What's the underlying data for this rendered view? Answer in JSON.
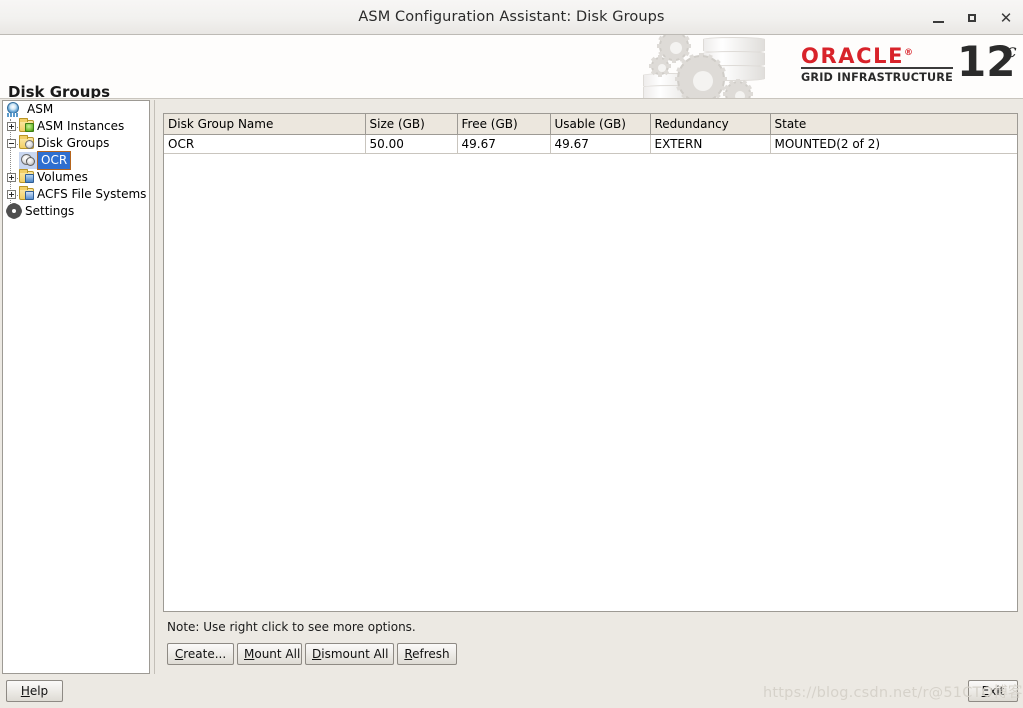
{
  "window": {
    "title": "ASM Configuration Assistant: Disk Groups",
    "minimize_label": "Minimize",
    "maximize_label": "Maximize",
    "close_label": "Close"
  },
  "header": {
    "page_title": "Disk Groups",
    "brand": {
      "name": "ORACLE",
      "registered_mark": "®",
      "product_line": "GRID INFRASTRUCTURE",
      "version_number": "12",
      "version_suffix": "c"
    },
    "brand_color": "#d8232a"
  },
  "sidebar": {
    "nodes": [
      {
        "label": "ASM",
        "icon": "asm-node-icon",
        "level": 0,
        "expander": "none",
        "selected": false
      },
      {
        "label": "ASM Instances",
        "icon": "asm-instances-icon",
        "level": 1,
        "expander": "plus",
        "selected": false
      },
      {
        "label": "Disk Groups",
        "icon": "disk-groups-icon",
        "level": 1,
        "expander": "minus",
        "selected": false
      },
      {
        "label": "OCR",
        "icon": "disk-group-item-icon",
        "level": 2,
        "expander": "none",
        "selected": true
      },
      {
        "label": "Volumes",
        "icon": "volumes-icon",
        "level": 1,
        "expander": "plus",
        "selected": false
      },
      {
        "label": "ACFS File Systems",
        "icon": "acfs-icon",
        "level": 1,
        "expander": "plus",
        "selected": false
      },
      {
        "label": "Settings",
        "icon": "settings-gear-icon",
        "level": 0,
        "expander": "none",
        "selected": false
      }
    ],
    "selection_bg": "#2f6fd0",
    "selection_focus_border": "#b5651d"
  },
  "table": {
    "columns": [
      "Disk Group Name",
      "Size (GB)",
      "Free (GB)",
      "Usable (GB)",
      "Redundancy",
      "State"
    ],
    "rows": [
      {
        "disk_group_name": "OCR",
        "size_gb": "50.00",
        "free_gb": "49.67",
        "usable_gb": "49.67",
        "redundancy": "EXTERN",
        "state": "MOUNTED(2 of 2)"
      }
    ]
  },
  "note": "Note: Use right click to see more options.",
  "actions": {
    "create": {
      "mnemonic": "C",
      "rest": "reate..."
    },
    "mount_all": {
      "mnemonic": "M",
      "rest": "ount All"
    },
    "dismount_all": {
      "mnemonic": "D",
      "rest": "ismount All"
    },
    "refresh": {
      "mnemonic": "R",
      "rest": "efresh"
    },
    "help": {
      "mnemonic": "H",
      "rest": "elp",
      "prefix": ""
    },
    "exit": {
      "mnemonic": "E",
      "rest": "xit"
    }
  },
  "watermark": "https://blog.csdn.net/r@51CTO博客"
}
